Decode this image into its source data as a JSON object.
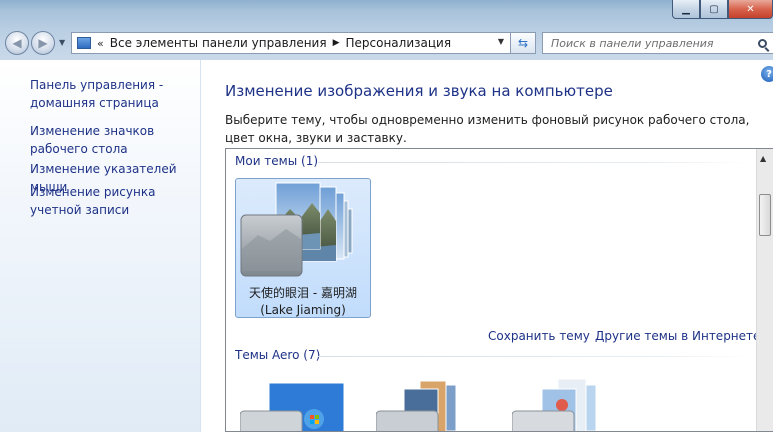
{
  "window": {
    "minimize_glyph": "▁",
    "maximize_glyph": "▢",
    "close_glyph": "✕"
  },
  "navigation": {
    "back_glyph": "◀",
    "forward_glyph": "▶",
    "history_glyph": "▼",
    "address": {
      "prefix": "«",
      "segments": [
        "Все элементы панели управления",
        "Персонализация"
      ],
      "separator": "▶",
      "dropdown_glyph": "▼"
    },
    "refresh_glyph": "⇆",
    "search": {
      "placeholder": "Поиск в панели управления"
    }
  },
  "sidebar": {
    "links": [
      {
        "label": "Панель управления - домашняя страница"
      },
      {
        "label": "Изменение значков рабочего стола"
      },
      {
        "label": "Изменение указателей мыши"
      },
      {
        "label": "Изменение рисунка учетной записи"
      }
    ]
  },
  "main": {
    "title": "Изменение изображения и звука на компьютере",
    "description": "Выберите тему, чтобы одновременно изменить фоновый рисунок рабочего стола, цвет окна, звуки и заставку.",
    "help_glyph": "?",
    "my_themes": {
      "header": "Мои темы (1)",
      "theme": {
        "name_line1": "天使的眼泪 - 嘉明湖",
        "name_line2": "(Lake Jiaming)"
      }
    },
    "links": {
      "save": "Сохранить тему",
      "online": "Другие темы в Интернете"
    },
    "aero_themes": {
      "header": "Темы Aero (7)"
    },
    "scroll_up_glyph": "▲"
  },
  "colors": {
    "link": "#1e3287",
    "selection_fill": "#c9e0fc",
    "selection_border": "#7da2ce"
  }
}
